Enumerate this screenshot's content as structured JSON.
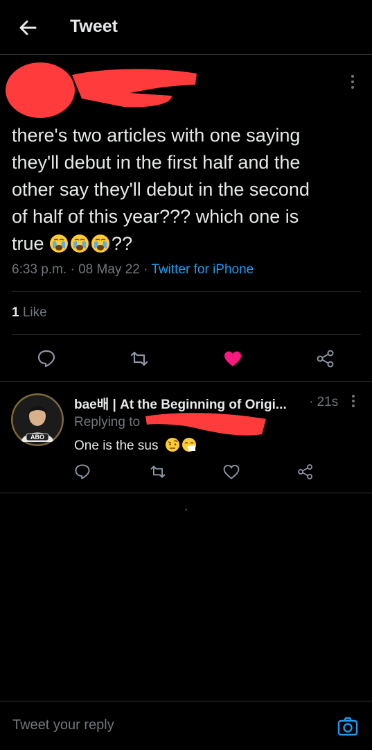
{
  "header": {
    "title": "Tweet"
  },
  "tweet": {
    "text_line1": "there's two articles with one saying",
    "text_line2": "they'll debut in the first half and the",
    "text_line3": "other say they'll debut in the second",
    "text_line4": "of half of this year??? which one is",
    "text_line5_start": "true",
    "text_line5_end": "??",
    "time": "6:33 p.m.",
    "date": "08 May 22",
    "source": "Twitter for iPhone",
    "like_count": "1",
    "like_label": "Like",
    "liked": true
  },
  "reply": {
    "author": "bae배 | At the Beginning of Origi...",
    "time": "21s",
    "replying_to_label": "Replying to",
    "text": "One is the sus",
    "avatar_badge": "ABO"
  },
  "composer": {
    "placeholder": "Tweet your reply"
  },
  "colors": {
    "accent": "#1d9bf0",
    "like": "#f91880",
    "redaction": "#ff3b3b",
    "background": "#000000"
  },
  "icons": {
    "back": "arrow-left-icon",
    "more": "more-vertical-icon",
    "reply": "reply-bubble-icon",
    "retweet": "retweet-icon",
    "like": "heart-icon",
    "share": "share-icon",
    "camera": "camera-icon",
    "emoji1": "loudly-crying-face-emoji",
    "emoji2": "face-with-raised-eyebrow-emoji",
    "emoji3": "sneezing-face-emoji"
  }
}
